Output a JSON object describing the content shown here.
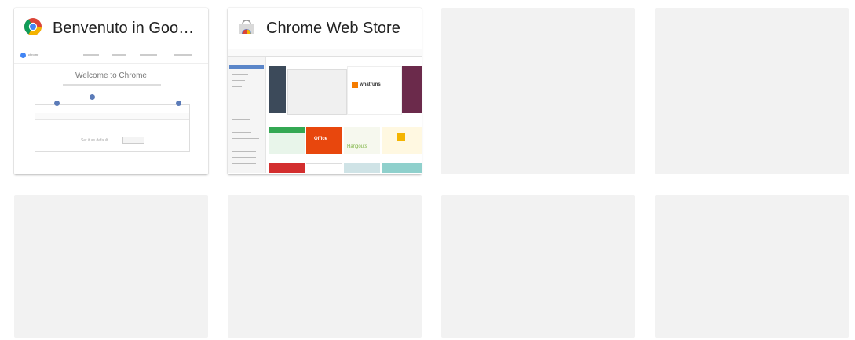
{
  "tiles": [
    {
      "title": "Benvenuto in Googl...",
      "icon": "chrome-icon",
      "thumbnail": {
        "brand": "chrome",
        "heading": "Welcome to Chrome",
        "default_text": "Set it as default"
      }
    },
    {
      "title": "Chrome Web Store",
      "icon": "web-store-icon",
      "thumbnail": {
        "featured_label": "whatruns",
        "tile_label_1": "Office",
        "tile_label_2": "Hangouts"
      }
    }
  ],
  "colors": {
    "empty_tile": "#f2f2f2",
    "chrome_red": "#db4437",
    "chrome_green": "#0f9d58",
    "chrome_yellow": "#f4b400",
    "chrome_blue": "#4285f4"
  }
}
